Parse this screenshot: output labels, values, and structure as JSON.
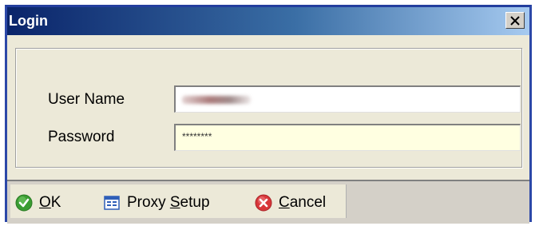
{
  "window": {
    "title": "Login",
    "close_glyph": "✕"
  },
  "form": {
    "username_label": "User Name",
    "username_value": "",
    "password_label": "Password",
    "password_value": "********"
  },
  "toolbar": {
    "ok": {
      "mnemonic": "O",
      "rest": "K",
      "icon": "check-icon"
    },
    "proxy": {
      "prefix": "Proxy ",
      "mnemonic": "S",
      "rest": "etup",
      "icon": "proxy-settings-icon"
    },
    "cancel": {
      "mnemonic": "C",
      "rest": "ancel",
      "icon": "cancel-icon"
    }
  },
  "colors": {
    "title_bar_start": "#0a246a",
    "title_bar_end": "#a6caf0",
    "password_field_bg": "#ffffe1",
    "ok_icon": "#3a9c32",
    "cancel_icon": "#d8373a"
  }
}
